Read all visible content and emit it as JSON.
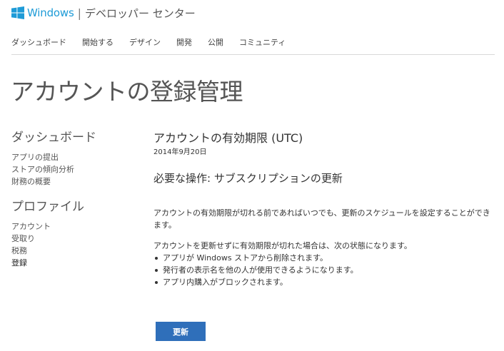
{
  "brand": {
    "logo_icon": "windows-logo-icon",
    "windows_label": "Windows",
    "separator": "|",
    "center_label": "デベロッパー センター",
    "accent_color": "#1e9bd7"
  },
  "topnav": {
    "items": [
      {
        "label": "ダッシュボード"
      },
      {
        "label": "開始する"
      },
      {
        "label": "デザイン"
      },
      {
        "label": "開発"
      },
      {
        "label": "公開"
      },
      {
        "label": "コミュニティ"
      }
    ]
  },
  "page": {
    "title": "アカウントの登録管理"
  },
  "sidebar": {
    "groups": [
      {
        "heading": "ダッシュボード",
        "items": [
          {
            "label": "アプリの提出"
          },
          {
            "label": "ストアの傾向分析"
          },
          {
            "label": "財務の概要"
          }
        ]
      },
      {
        "heading": "プロファイル",
        "items": [
          {
            "label": "アカウント"
          },
          {
            "label": "受取り"
          },
          {
            "label": "税務"
          },
          {
            "label": "登録"
          }
        ]
      }
    ]
  },
  "main": {
    "expiry_heading": "アカウントの有効期限 (UTC)",
    "expiry_date": "2014年9月20日",
    "action_heading": "必要な操作: サブスクリプションの更新",
    "paragraph1": "アカウントの有効期限が切れる前であればいつでも、更新のスケジュールを設定することができます。",
    "paragraph2": "アカウントを更新せずに有効期限が切れた場合は、次の状態になります。",
    "bullets": [
      "アプリが Windows ストアから削除されます。",
      "発行者の表示名を他の人が使用できるようになります。",
      "アプリ内購入がブロックされます。"
    ],
    "renew_button_label": "更新",
    "button_color": "#2f6fba"
  }
}
